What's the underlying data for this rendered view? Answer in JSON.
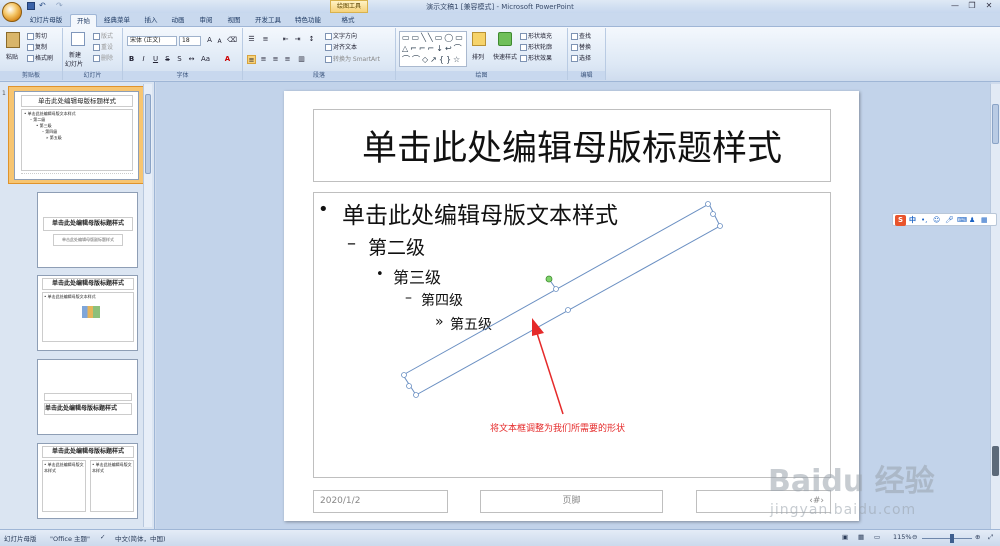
{
  "window": {
    "app_title": "演示文稿1 [兼容模式] - Microsoft PowerPoint",
    "tools_badge": "绘图工具",
    "min": "—",
    "max": "❐",
    "close": "✕"
  },
  "tabs": [
    "幻灯片母版",
    "开始",
    "经典菜单",
    "插入",
    "动画",
    "审阅",
    "视图",
    "开发工具",
    "特色功能",
    "格式"
  ],
  "ribbon": {
    "clipboard": {
      "paste": "粘贴",
      "cut": "剪切",
      "copy": "复制",
      "format_painter": "格式刷",
      "label": "剪贴板"
    },
    "slides": {
      "new_slide": "新建",
      "new_slide2": "幻灯片",
      "layout": "版式",
      "reset": "重设",
      "delete": "删除",
      "label": "幻灯片"
    },
    "font": {
      "font_name": "宋体 (正文)",
      "font_size": "18",
      "label": "字体"
    },
    "paragraph": {
      "text_direction": "文字方向",
      "align_text": "对齐文本",
      "smartart": "转换为 SmartArt",
      "label": "段落"
    },
    "drawing": {
      "arrange": "排列",
      "quick_styles": "快速样式",
      "fill": "形状填充",
      "outline": "形状轮廓",
      "effects": "形状效果",
      "label": "绘图"
    },
    "editing": {
      "find": "查找",
      "replace": "替换",
      "select": "选择",
      "label": "编辑"
    }
  },
  "thumbnails": {
    "t1_title": "单击此处编辑母版标题样式",
    "t1_line1": "• 单击此处编辑母版文本样式",
    "t1_line2": "– 第二级",
    "t1_line3": "• 第三级",
    "t1_line4": "– 第四级",
    "t1_line5": "» 第五级",
    "t2_title": "单击此处编辑母版标题样式",
    "t2_sub": "单击此处编辑母版副标题样式",
    "t3_title": "单击此处编辑母版标题样式",
    "t3_line1": "• 单击此处编辑母版文本样式",
    "t4_title": "单击此处编辑母版标题样式",
    "t5_title": "单击此处编辑母版标题样式",
    "t5_left": "• 单击此处编辑母版文本样式",
    "t5_right": "• 单击此处编辑母版文本样式"
  },
  "slide": {
    "title": "单击此处编辑母版标题样式",
    "level1": "单击此处编辑母版文本样式",
    "level2": "第二级",
    "level3": "第三级",
    "level4": "第四级",
    "level5": "第五级",
    "date": "2020/1/2",
    "footer": "页脚",
    "page_num": "‹#›",
    "bullet1": "•",
    "bullet2": "–",
    "bullet3": "•",
    "bullet4": "–",
    "bullet5": "»"
  },
  "annotation": {
    "note": "将文本框调整为我们所需要的形状",
    "color": "#e52a2a"
  },
  "statusbar": {
    "view": "幻灯片母版",
    "theme": "\"Office 主题\"",
    "language": "中文(简体，中国)",
    "zoom": "115%"
  },
  "sogou": {
    "label": "中"
  },
  "watermark": {
    "brand": "Baidu 经验",
    "url": "jingyan.baidu.com"
  }
}
